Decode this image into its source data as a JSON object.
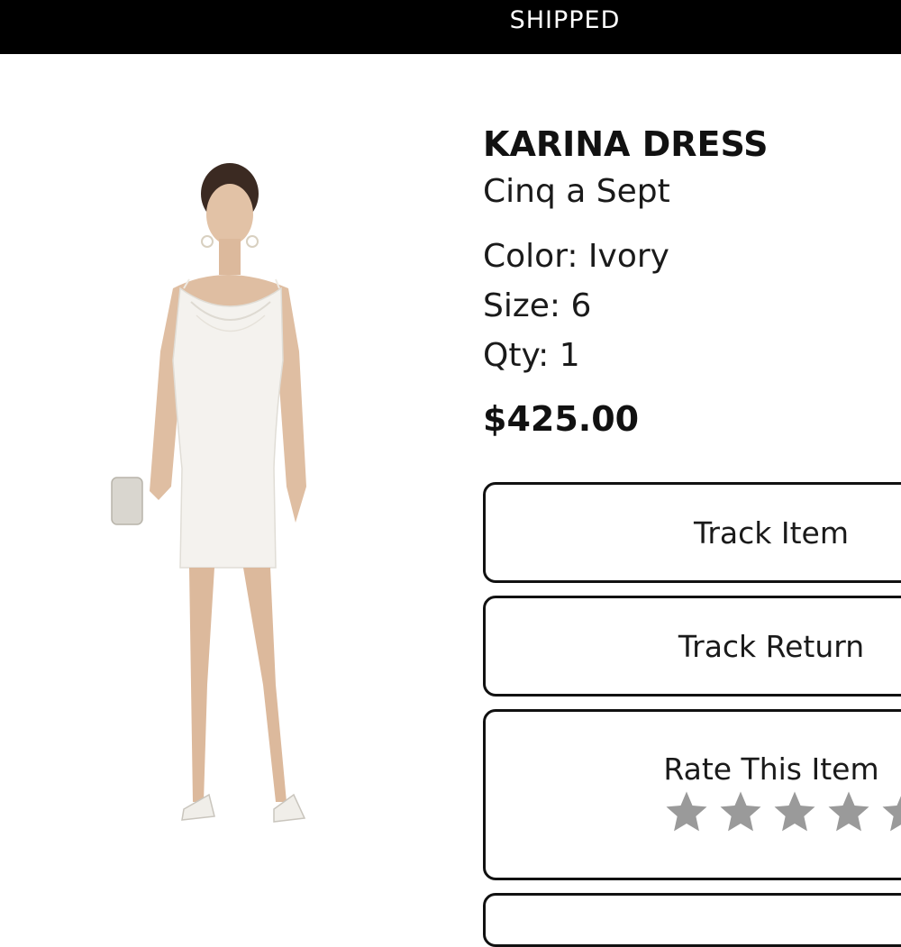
{
  "status_bar": {
    "label": "SHIPPED"
  },
  "product": {
    "name": "KARINA DRESS",
    "brand": "Cinq a Sept",
    "color": "Color: Ivory",
    "size": "Size: 6",
    "qty": "Qty: 1",
    "price": "$425.00"
  },
  "actions": {
    "track_item": "Track Item",
    "track_return": "Track Return",
    "rate_item": "Rate This Item"
  },
  "rating": {
    "value": 0,
    "max": 5
  },
  "colors": {
    "header_bg": "#000000",
    "header_text": "#ffffff",
    "star_empty": "#9a9a9a",
    "dress": "#f4f2ee"
  }
}
